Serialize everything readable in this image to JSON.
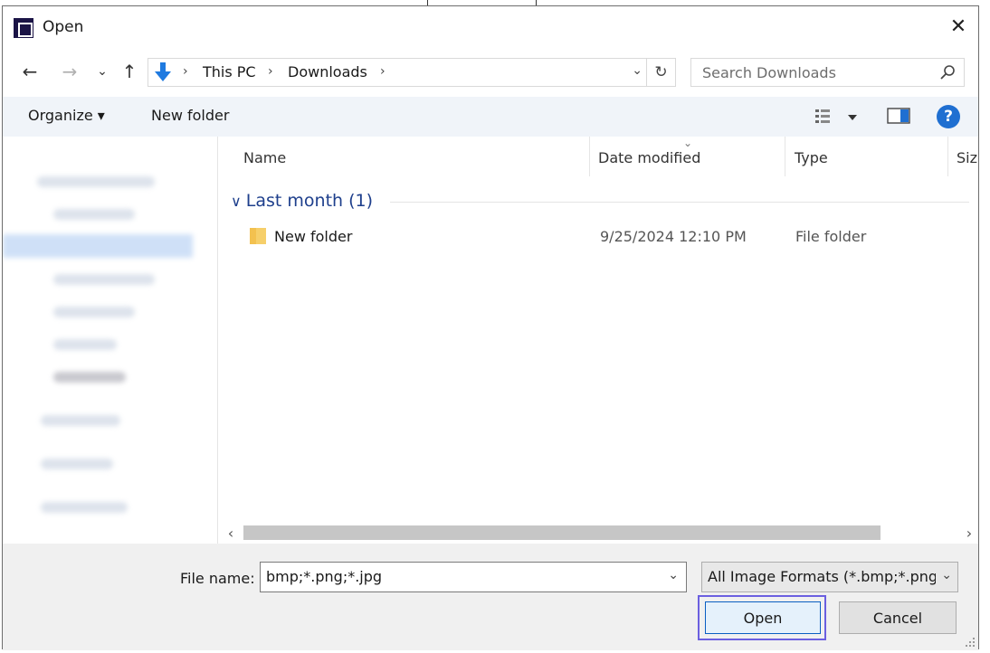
{
  "dialog": {
    "title": "Open"
  },
  "nav": {
    "back": "←",
    "forward": "→",
    "recent": "⌄",
    "up": "↑"
  },
  "address": {
    "crumbs": [
      "This PC",
      "Downloads"
    ],
    "separator": "›"
  },
  "search": {
    "placeholder": "Search Downloads"
  },
  "commands": {
    "organize": "Organize ▾",
    "new_folder": "New folder",
    "help": "?"
  },
  "columns": [
    "Name",
    "Date modified",
    "Type",
    "Size"
  ],
  "groups": [
    {
      "label": "Last month (1)",
      "items": [
        {
          "name": "New folder",
          "date": "9/25/2024 12:10 PM",
          "type": "File folder"
        }
      ]
    }
  ],
  "bottom": {
    "file_name_label": "File name:",
    "file_name_value": "bmp;*.png;*.jpg",
    "file_type_value": "All Image Formats (*.bmp;*.png;*.jpg)",
    "open_label": "Open",
    "cancel_label": "Cancel"
  },
  "colors": {
    "accent": "#1f6fd1",
    "group_header": "#1e3f8c",
    "focus_ring": "#6b5fe0",
    "command_bar": "#f0f4f9"
  },
  "icons": [
    "app-icon",
    "close-icon",
    "back-arrow-icon",
    "forward-arrow-icon",
    "recent-locations-icon",
    "up-arrow-icon",
    "downloads-icon",
    "refresh-icon",
    "search-icon",
    "view-options-icon",
    "preview-pane-icon",
    "help-icon",
    "folder-icon",
    "chevron-down-icon"
  ]
}
